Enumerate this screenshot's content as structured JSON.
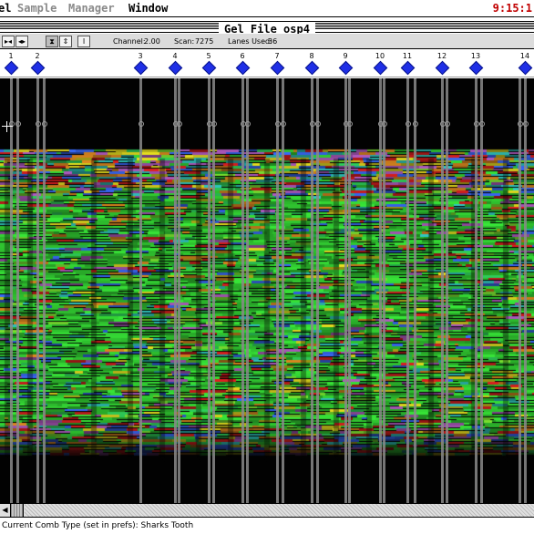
{
  "menubar": {
    "items": [
      {
        "label": "el",
        "state": "active"
      },
      {
        "label": "Sample",
        "state": "disabled"
      },
      {
        "label": "Manager",
        "state": "disabled"
      },
      {
        "label": "Window",
        "state": "active"
      }
    ],
    "clock": "9:15:1"
  },
  "window": {
    "title": "Gel File osp4"
  },
  "toolbar": {
    "buttons": [
      {
        "name": "lane-nav",
        "glyph": "▸◂"
      },
      {
        "name": "lane-adjust",
        "glyph": "◂▸"
      },
      {
        "name": "zoom-vertical",
        "glyph": "⧗"
      },
      {
        "name": "scale",
        "glyph": "⇕"
      },
      {
        "name": "cursor",
        "glyph": "I"
      }
    ],
    "channel_label": "Channel:",
    "channel_value": "2.00",
    "scan_label": "Scan:",
    "scan_value": "7275",
    "lanes_used_label": "Lanes Used:",
    "lanes_used_value": "36"
  },
  "lanes": [
    "1",
    "2",
    "3",
    "4",
    "5",
    "6",
    "7",
    "8",
    "9",
    "10",
    "11",
    "12",
    "13",
    "14"
  ],
  "colors": {
    "lane_marker": "#1f2fe6",
    "clock": "#c00000",
    "gel_background": "#020202",
    "band_green": "#38e838",
    "band_red": "#e02020",
    "band_blue": "#3a6cff",
    "band_yellow": "#e8e020"
  },
  "status": {
    "text": "Current Comb Type (set in prefs): Sharks Tooth"
  }
}
